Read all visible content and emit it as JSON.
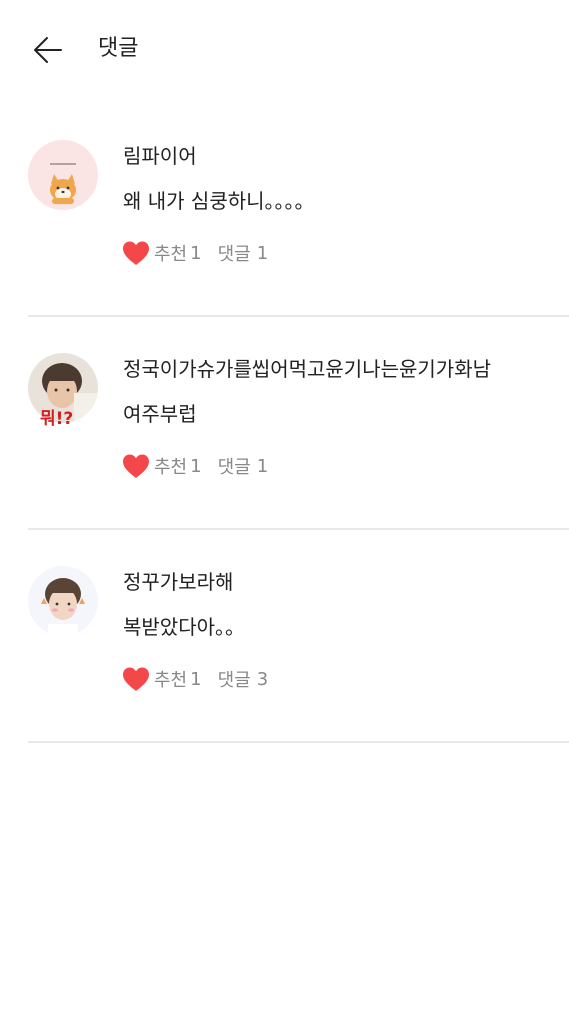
{
  "header": {
    "title": "댓글",
    "back_icon": "arrow-left-icon"
  },
  "colors": {
    "heart": "#f4474a",
    "meta_text": "#888888",
    "divider": "#e8e8e8"
  },
  "comments": [
    {
      "username": "림파이어",
      "text": "왜 내가 심쿵하니。。。。",
      "like_label": "추천",
      "like_count": "1",
      "reply_label": "댓글",
      "reply_count": "1",
      "avatar": "avatar-shiba-icon"
    },
    {
      "username": "정국이가슈가를씹어먹고윤기나는윤기가화남",
      "text": "여주부럽",
      "like_label": "추천",
      "like_count": "1",
      "reply_label": "댓글",
      "reply_count": "1",
      "avatar": "avatar-person-icon",
      "avatar_caption": "뭐!?"
    },
    {
      "username": "정꾸가보라해",
      "text": "복받았다아。。",
      "like_label": "추천",
      "like_count": "1",
      "reply_label": "댓글",
      "reply_count": "3",
      "avatar": "avatar-person-icon"
    }
  ]
}
